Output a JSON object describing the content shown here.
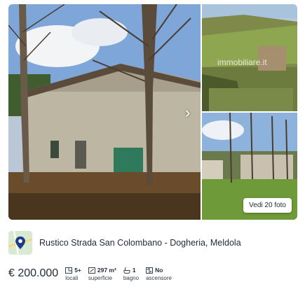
{
  "gallery": {
    "watermark": "immobiliare.it",
    "see_photos_label": "Vedi 20 foto",
    "next_icon": "chevron-right-icon"
  },
  "listing": {
    "title": "Rustico Strada San Colombano - Dogheria, Meldola",
    "price": "€ 200.000",
    "features": [
      {
        "icon": "rooms-icon",
        "value": "5+",
        "label": "locali"
      },
      {
        "icon": "area-icon",
        "value": "297 m²",
        "label": "superficie"
      },
      {
        "icon": "bath-icon",
        "value": "1",
        "label": "bagno"
      },
      {
        "icon": "elevator-icon",
        "value": "No",
        "label": "ascensore"
      }
    ]
  }
}
